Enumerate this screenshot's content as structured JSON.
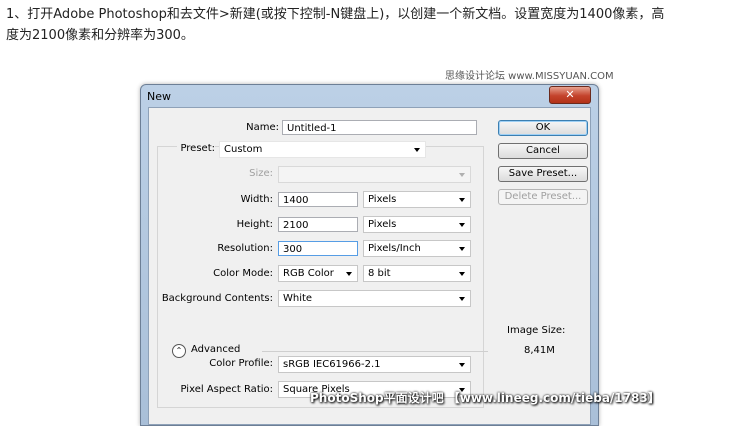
{
  "intro": {
    "line1": "1、打开Adobe Photoshop和去文件>新建(或按下控制-N键盘上)，以创建一个新文档。设置宽度为1400像素，高",
    "line2": "度为2100像素和分辨率为300。"
  },
  "watermark_top": "思缘设计论坛 www.MISSYUAN.COM",
  "watermark_bottom": "PhotoShop平面设计吧 【www.lineeg.com/tieba/1783】",
  "dialog": {
    "title": "New",
    "close_label": "✕",
    "name": {
      "label": "Name:",
      "value": "Untitled-1"
    },
    "preset": {
      "label": "Preset:",
      "value": "Custom"
    },
    "size": {
      "label": "Size:",
      "value": ""
    },
    "width": {
      "label": "Width:",
      "value": "1400",
      "unit": "Pixels"
    },
    "height": {
      "label": "Height:",
      "value": "2100",
      "unit": "Pixels"
    },
    "resolution": {
      "label": "Resolution:",
      "value": "300",
      "unit": "Pixels/Inch"
    },
    "color_mode": {
      "label": "Color Mode:",
      "value": "RGB Color",
      "depth": "8 bit"
    },
    "background": {
      "label": "Background Contents:",
      "value": "White"
    },
    "advanced": {
      "icon": "collapse-up-icon",
      "glyph": "⌃",
      "label": "Advanced"
    },
    "color_profile": {
      "label": "Color Profile:",
      "value": "sRGB IEC61966-2.1"
    },
    "pixel_aspect": {
      "label": "Pixel Aspect Ratio:",
      "value": "Square Pixels"
    },
    "buttons": {
      "ok": "OK",
      "cancel": "Cancel",
      "save_preset": "Save Preset...",
      "delete_preset": "Delete Preset..."
    },
    "image_size": {
      "label": "Image Size:",
      "value": "8,41M"
    }
  }
}
